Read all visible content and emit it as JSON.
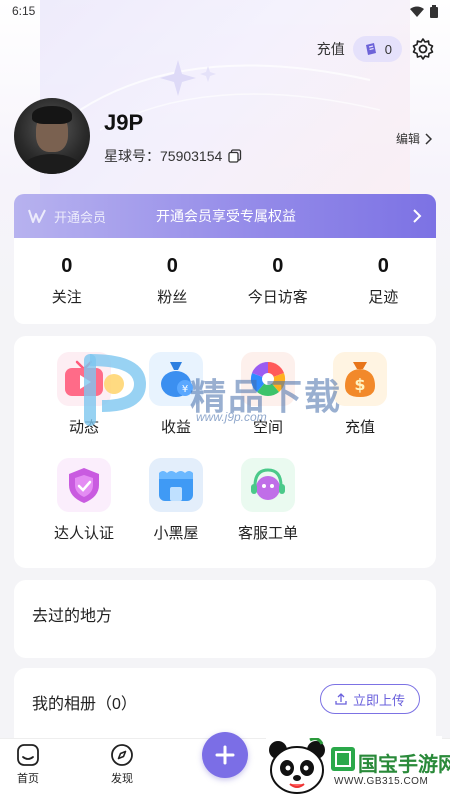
{
  "status_bar": {
    "time": "6:15"
  },
  "header": {
    "recharge_label": "充值",
    "coin_count": "0"
  },
  "profile": {
    "username": "J9P",
    "star_id": "星球号：75903154",
    "edit_label": "编辑"
  },
  "vip": {
    "badge": "开通会员",
    "text": "开通会员享受专属权益"
  },
  "stats": [
    {
      "value": "0",
      "label": "关注"
    },
    {
      "value": "0",
      "label": "粉丝"
    },
    {
      "value": "0",
      "label": "今日访客"
    },
    {
      "value": "0",
      "label": "足迹"
    }
  ],
  "functions": [
    {
      "label": "动态",
      "icon": "video-play-icon"
    },
    {
      "label": "收益",
      "icon": "money-bag-icon"
    },
    {
      "label": "空间",
      "icon": "camera-aperture-icon"
    },
    {
      "label": "充值",
      "icon": "dollar-bag-icon"
    },
    {
      "label": "达人认证",
      "icon": "verified-shield-icon"
    },
    {
      "label": "小黑屋",
      "icon": "store-icon"
    },
    {
      "label": "客服工单",
      "icon": "headset-mascot-icon"
    }
  ],
  "places": {
    "title": "去过的地方"
  },
  "album": {
    "title": "我的相册（0）",
    "upload_label": "立即上传"
  },
  "tabbar": {
    "home_label": "首页",
    "discover_label": "发现"
  },
  "watermarks": {
    "center_brand": "精品下载",
    "center_url": "www.j9p.com",
    "bottom_brand": "国宝手游网",
    "bottom_url": "WWW.GB315.COM"
  },
  "colors": {
    "accent": "#7b6ee6",
    "vip_gradient_end": "#7c72e4",
    "background": "#f4f4f7"
  }
}
